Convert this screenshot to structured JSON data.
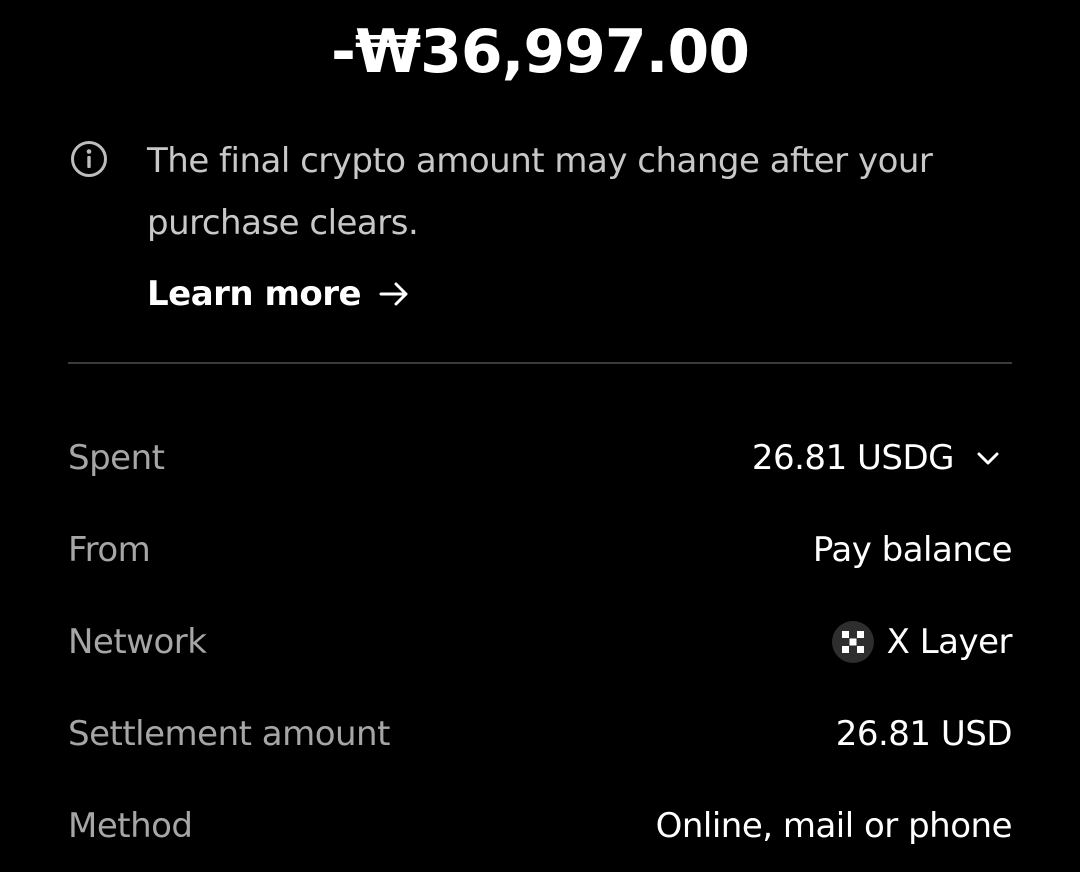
{
  "header": {
    "amount": "-₩36,997.00"
  },
  "notice": {
    "icon": "info-icon",
    "text": "The final crypto amount may change after your purchase clears.",
    "learn_more_label": "Learn more",
    "learn_more_icon": "arrow-right-icon"
  },
  "details": {
    "spent": {
      "label": "Spent",
      "value": "26.81 USDG",
      "icon": "chevron-down-icon"
    },
    "from": {
      "label": "From",
      "value": "Pay balance"
    },
    "network": {
      "label": "Network",
      "value": "X Layer",
      "icon": "x-layer-logo-icon"
    },
    "settlement": {
      "label": "Settlement amount",
      "value": "26.81 USD"
    },
    "method": {
      "label": "Method",
      "value": "Online, mail or phone"
    }
  },
  "colors": {
    "background": "#000000",
    "primary_text": "#ffffff",
    "secondary_text": "#a6a6a6",
    "divider": "#3a3a3a"
  }
}
